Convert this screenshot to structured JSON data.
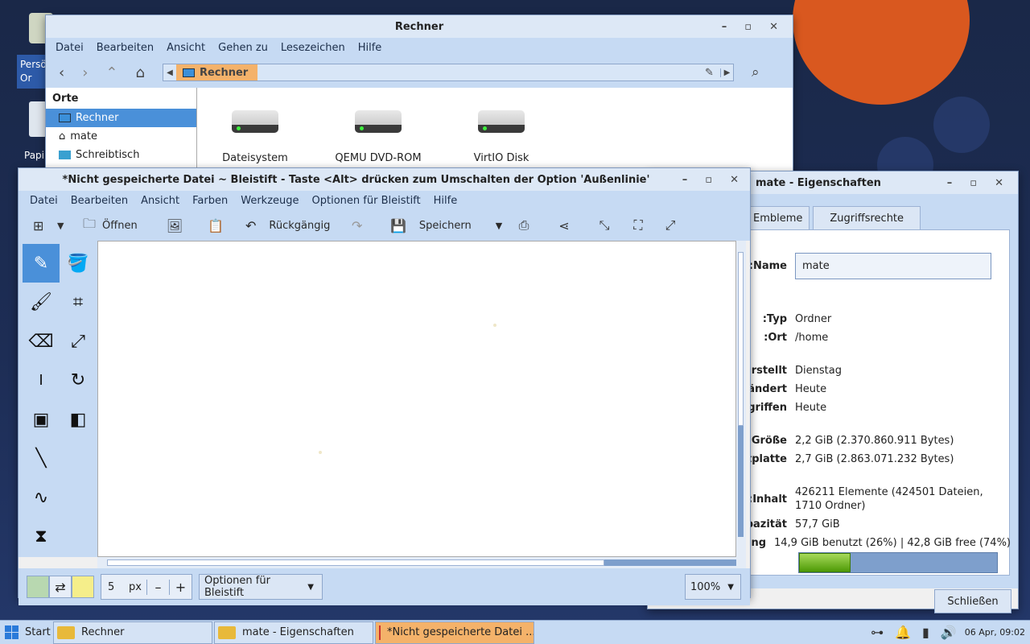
{
  "desktop": {
    "icons": [
      {
        "label": "Persö Or"
      },
      {
        "label": "Papi"
      }
    ]
  },
  "file_manager": {
    "title": "Rechner",
    "menu": [
      "Datei",
      "Bearbeiten",
      "Ansicht",
      "Gehen zu",
      "Lesezeichen",
      "Hilfe"
    ],
    "location": "Rechner",
    "sidebar_heading": "Orte",
    "places": [
      "Rechner",
      "mate",
      "Schreibtisch"
    ],
    "drives": [
      "Dateisystem",
      "QEMU DVD-ROM",
      "VirtIO Disk"
    ]
  },
  "paint": {
    "title": "*Nicht gespeicherte Datei ~ Bleistift - Taste <Alt> drücken zum Umschalten der Option 'Außenlinie'",
    "menu": [
      "Datei",
      "Bearbeiten",
      "Ansicht",
      "Farben",
      "Werkzeuge",
      "Optionen für Bleistift",
      "Hilfe"
    ],
    "toolbar": {
      "open": "Öffnen",
      "undo": "Rückgängig",
      "save": "Speichern"
    },
    "tools": [
      "pencil",
      "fill",
      "brush",
      "crop",
      "eraser",
      "scale",
      "text",
      "rotate",
      "rect-select",
      "filters",
      "line",
      "curve",
      "free-shape"
    ],
    "bottom": {
      "size_value": "5",
      "size_unit": "px",
      "minus": "–",
      "plus": "+",
      "options": "Optionen für Bleistift",
      "zoom": "100%"
    }
  },
  "properties": {
    "title": "mate - Eigenschaften",
    "tabs": [
      "Embleme",
      "Zugriffsrechte"
    ],
    "name_label": "Name:",
    "name_value": "mate",
    "rows": [
      {
        "label": "Typ:",
        "value": "Ordner"
      },
      {
        "label": "Ort:",
        "value": "/home"
      },
      {
        "label": "Erstellt:",
        "value": "Dienstag"
      },
      {
        "label": "Geändert:",
        "value": "Heute"
      },
      {
        "label": "Zugegriffen:",
        "value": "Heute"
      },
      {
        "label": "Größe:",
        "value": "2,2 GiB (2.370.860.911 Bytes)"
      },
      {
        "label": "Auf Festplatte:",
        "value": "2,7 GiB (2.863.071.232 Bytes)"
      },
      {
        "label": "Inhalt:",
        "value": "426211 Elemente (424501 Dateien, 1710 Ordner)"
      },
      {
        "label": "Kapazität:",
        "value": "57,7 GiB"
      },
      {
        "label": "Verwendung:",
        "value": "14,9 GiB benutzt (26%) | 42,8 GiB free (74%)"
      }
    ],
    "usage_fraction": 0.26,
    "close_button": "Schließen"
  },
  "taskbar": {
    "start": "Start",
    "tasks": [
      "Rechner",
      "mate - Eigenschaften",
      "*Nicht gespeicherte Datei ..."
    ],
    "clock": "06 Apr, 09:02"
  }
}
